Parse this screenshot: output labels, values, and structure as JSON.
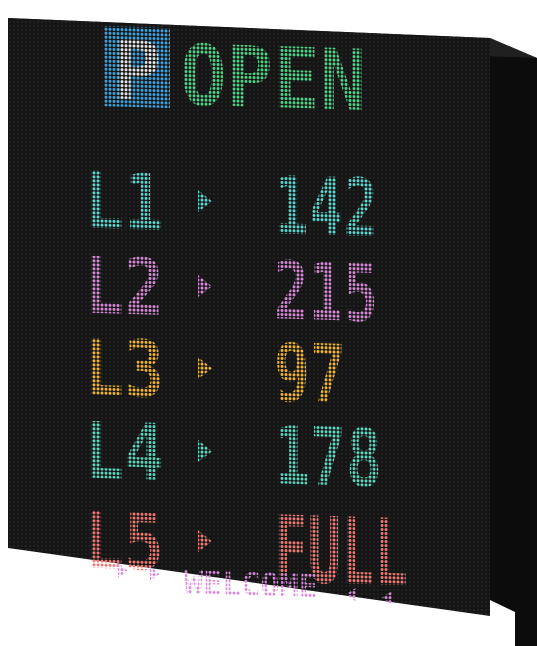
{
  "sign": {
    "parking_symbol": "P",
    "status": "OPEN",
    "footer": "WELCOME",
    "levels": [
      {
        "label": "L1",
        "value": "142",
        "color": "#5fd8d0"
      },
      {
        "label": "L2",
        "value": "215",
        "color": "#d88ad8"
      },
      {
        "label": "L3",
        "value": "97",
        "color": "#f2b632"
      },
      {
        "label": "L4",
        "value": "178",
        "color": "#5fd8bf"
      },
      {
        "label": "L5",
        "value": "FULL",
        "color": "#f07a74"
      }
    ]
  },
  "colors": {
    "panel": "#1a1a1a",
    "parking_box": "#3fa3df",
    "status": "#52d486",
    "footer": "#d88ad8",
    "arrow_footer": "#d88ad8"
  }
}
